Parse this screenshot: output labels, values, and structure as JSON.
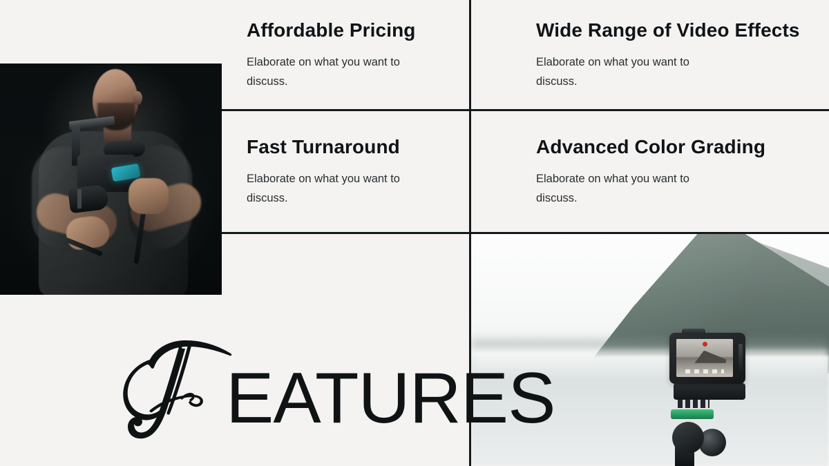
{
  "slide": {
    "background_color": "#f4f3f2",
    "rule_color": "#14191b",
    "title": {
      "script_letter": "F",
      "rest": "EATURES",
      "full_text": "FEATURES"
    }
  },
  "features": [
    {
      "id": "affordable-pricing",
      "title": "Affordable Pricing",
      "body": "Elaborate on what you want to discuss."
    },
    {
      "id": "wide-range-of-video-effects",
      "title": "Wide Range of Video Effects",
      "body": "Elaborate on what you want to discuss."
    },
    {
      "id": "fast-turnaround",
      "title": "Fast Turnaround",
      "body": "Elaborate on what you want to discuss."
    },
    {
      "id": "advanced-color-grading",
      "title": "Advanced Color Grading",
      "body": "Elaborate on what you want to discuss."
    }
  ],
  "images": {
    "left": {
      "name": "videographer-photo",
      "description": "Videographer in dark studio holding a camera rig with teal gimbal handle",
      "accent_color": "#2bb8c8",
      "background_color": "#090d0e"
    },
    "bottom_right": {
      "name": "action-camera-lake-photo",
      "description": "Action camera on a tripod facing a lake with a blurred mountain",
      "accent_color": "#3cc07a",
      "background_color": "#fbfbfb"
    }
  }
}
